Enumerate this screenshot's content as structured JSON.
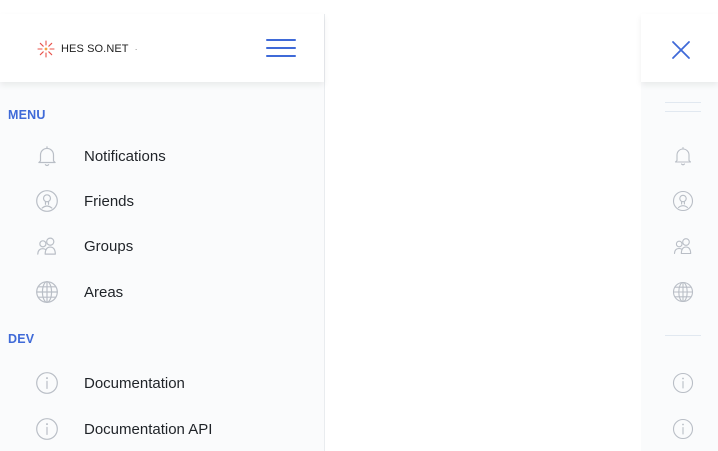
{
  "brand": {
    "logo_text": "HES SO.NET",
    "logo_suffix": "·"
  },
  "menu_section": {
    "title": "MENU",
    "items": [
      {
        "label": "Notifications",
        "icon": "bell-icon"
      },
      {
        "label": "Friends",
        "icon": "user-icon"
      },
      {
        "label": "Groups",
        "icon": "users-icon"
      },
      {
        "label": "Areas",
        "icon": "globe-icon"
      }
    ]
  },
  "dev_section": {
    "title": "DEV",
    "items": [
      {
        "label": "Documentation",
        "icon": "info-icon"
      },
      {
        "label": "Documentation API",
        "icon": "info-icon"
      }
    ]
  },
  "colors": {
    "accent": "#3f6ad8",
    "icon_stroke": "#b9bec6",
    "sidebar_bg": "#fafbfc"
  }
}
